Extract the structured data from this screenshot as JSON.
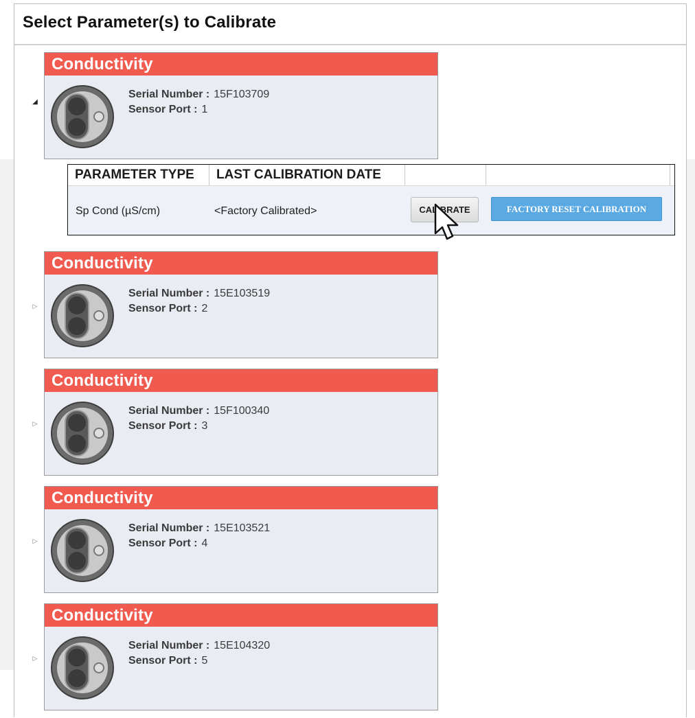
{
  "panel": {
    "title": "Select Parameter(s) to Calibrate"
  },
  "sensors": [
    {
      "type": "Conductivity",
      "serial_label": "Serial Number :",
      "serial": "15F103709",
      "port_label": "Sensor Port :",
      "port": "1",
      "expanded": true
    },
    {
      "type": "Conductivity",
      "serial_label": "Serial Number :",
      "serial": "15E103519",
      "port_label": "Sensor Port :",
      "port": "2",
      "expanded": false
    },
    {
      "type": "Conductivity",
      "serial_label": "Serial Number :",
      "serial": "15F100340",
      "port_label": "Sensor Port :",
      "port": "3",
      "expanded": false
    },
    {
      "type": "Conductivity",
      "serial_label": "Serial Number :",
      "serial": "15E103521",
      "port_label": "Sensor Port :",
      "port": "4",
      "expanded": false
    },
    {
      "type": "Conductivity",
      "serial_label": "Serial Number :",
      "serial": "15E104320",
      "port_label": "Sensor Port :",
      "port": "5",
      "expanded": false
    }
  ],
  "param_table": {
    "columns": [
      "PARAMETER TYPE",
      "LAST CALIBRATION DATE",
      "",
      ""
    ],
    "rows": [
      {
        "parameter": "Sp Cond (µS/cm)",
        "last_calibration": "<Factory Calibrated>",
        "calibrate_label": "CALIBRATE",
        "reset_label": "FACTORY RESET CALIBRATION"
      }
    ]
  },
  "icons": {
    "sensor": "conductivity-sensor-icon",
    "expanded": "triangle-expanded-icon",
    "collapsed": "triangle-collapsed-icon",
    "cursor": "mouse-pointer-icon"
  },
  "colors": {
    "card_header": "#f05a4f",
    "card_body": "#e9ecf3",
    "reset_button": "#5aa9e3",
    "param_row": "#eef1f8"
  }
}
